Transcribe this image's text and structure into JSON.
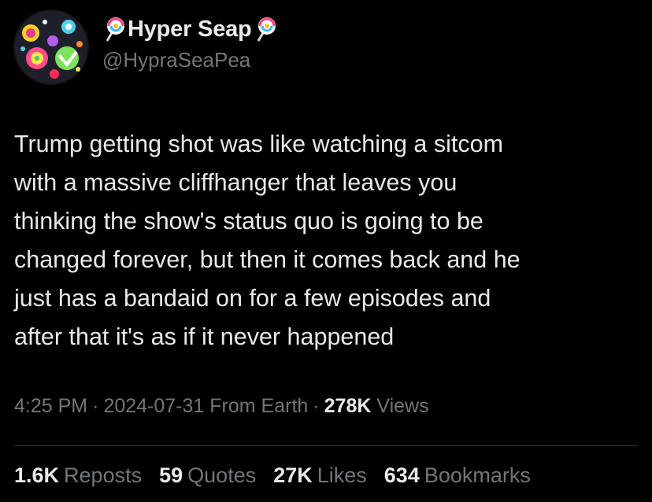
{
  "author": {
    "display_name": "Hyper Seap",
    "handle": "@HypraSeaPea",
    "name_emoji": "lollipop-icon"
  },
  "tweet": {
    "text": "Trump getting shot was like watching a sitcom\nwith a massive cliffhanger that leaves you\nthinking the show's status quo is going to be\nchanged forever, but then it comes back and he\njust has a bandaid on for a few episodes and\nafter that it's as if it never happened"
  },
  "meta": {
    "time": "4:25 PM",
    "date": "2024-07-31",
    "location": "From Earth",
    "separator": "·",
    "views_count": "278K",
    "views_label": "Views"
  },
  "stats": {
    "reposts_count": "1.6K",
    "reposts_label": "Reposts",
    "quotes_count": "59",
    "quotes_label": "Quotes",
    "likes_count": "27K",
    "likes_label": "Likes",
    "bookmarks_count": "634",
    "bookmarks_label": "Bookmarks"
  },
  "colors": {
    "background": "#000000",
    "primary_text": "#e7e9ea",
    "secondary_text": "#71767b",
    "divider": "#2f3336"
  }
}
